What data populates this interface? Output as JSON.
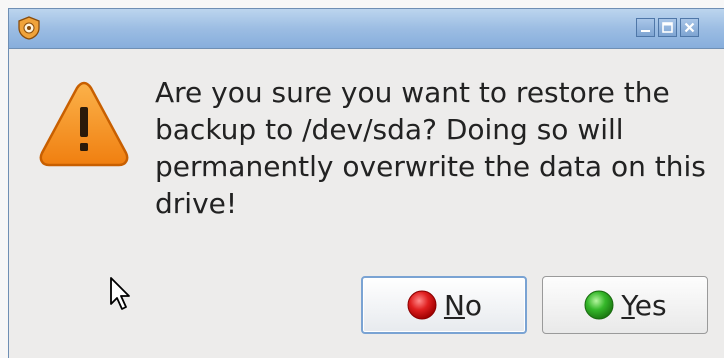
{
  "dialog": {
    "message": "Are you sure you want to restore the backup to /dev/sda? Doing so will permanently overwrite the data on this drive!",
    "icon": "warning-icon",
    "app_icon": "app-shield-icon"
  },
  "window_controls": {
    "minimize_icon": "minimize-icon",
    "maximize_icon": "maximize-icon",
    "close_icon": "close-icon"
  },
  "buttons": {
    "no": {
      "mnemonic": "N",
      "rest": "o",
      "icon": "red-circle-icon",
      "color": "#e02020"
    },
    "yes": {
      "mnemonic": "Y",
      "rest": "es",
      "icon": "green-circle-icon",
      "color": "#35b82a"
    }
  },
  "colors": {
    "titlebar": "#9cbde3",
    "warning_fill": "#f7941d",
    "focus_border": "#7aa3d3"
  }
}
